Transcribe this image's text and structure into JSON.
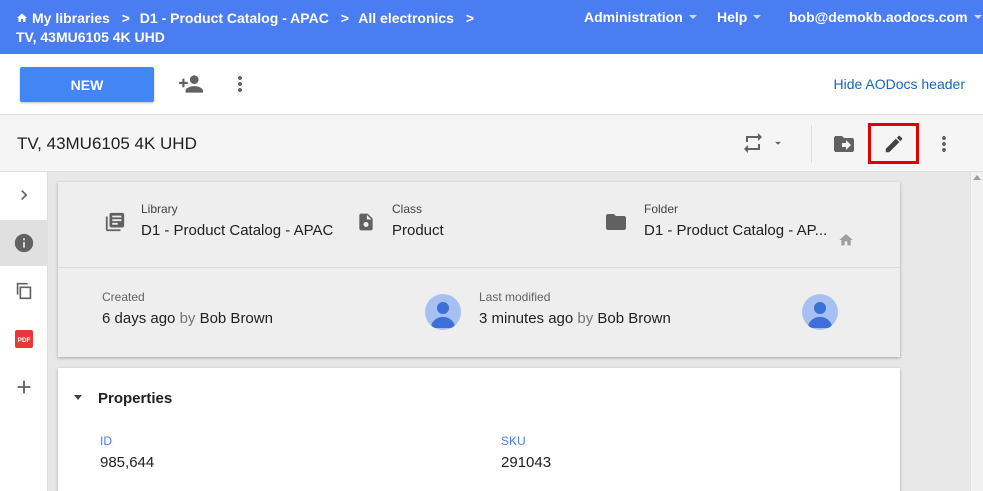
{
  "topbar": {
    "breadcrumbs": [
      "My libraries",
      "D1 - Product Catalog - APAC",
      "All electronics"
    ],
    "current": "TV, 43MU6105 4K UHD",
    "menu": {
      "administration": "Administration",
      "help": "Help",
      "user": "bob@demokb.aodocs.com"
    },
    "color": "#4a7cf2"
  },
  "actionbar": {
    "new_label": "NEW",
    "hide_header_label": "Hide AODocs header"
  },
  "document": {
    "title": "TV, 43MU6105 4K UHD"
  },
  "info": {
    "library": {
      "label": "Library",
      "value": "D1 - Product Catalog - APAC"
    },
    "class": {
      "label": "Class",
      "value": "Product"
    },
    "folder": {
      "label": "Folder",
      "value": "D1 - Product Catalog - AP..."
    },
    "created": {
      "label": "Created",
      "value": "6 days ago",
      "by": "by",
      "user": "Bob Brown"
    },
    "modified": {
      "label": "Last modified",
      "value": "3 minutes ago",
      "by": "by",
      "user": "Bob Brown"
    }
  },
  "properties": {
    "title": "Properties",
    "fields": [
      {
        "label": "ID",
        "value": "985,644"
      },
      {
        "label": "SKU",
        "value": "291043"
      }
    ]
  },
  "left_rail": {
    "pdf_label": "PDF"
  },
  "highlight_color": "#e00000"
}
